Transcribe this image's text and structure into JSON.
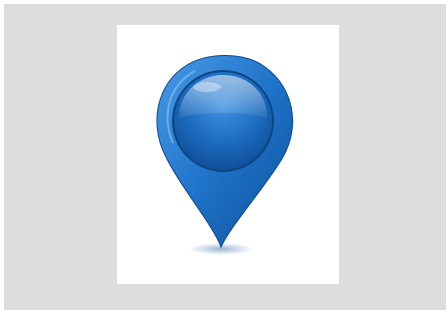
{
  "image": {
    "subject": "map-pin-icon",
    "colors": {
      "background_outer": "#ffffff",
      "background_panel": "#dcdddf",
      "card": "#ffffff",
      "pin_primary": "#1f73c9",
      "pin_dark": "#0d4f9a",
      "pin_light": "#5aa9f0",
      "shadow": "#9db8d1"
    }
  }
}
